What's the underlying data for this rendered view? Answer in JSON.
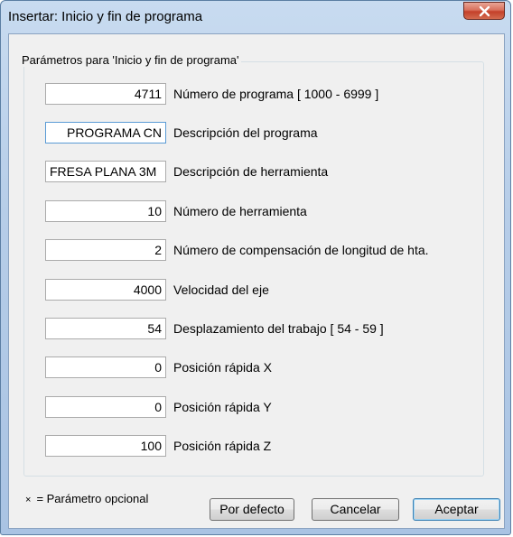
{
  "window": {
    "title": "Insertar: Inicio y fin de programa"
  },
  "group": {
    "label": "Parámetros para 'Inicio y fin de programa'"
  },
  "fields": [
    {
      "value": "4711",
      "label": "Número de programa  [ 1000 - 6999 ]"
    },
    {
      "value": "PROGRAMA CN",
      "label": "Descripción del programa"
    },
    {
      "value": "FRESA PLANA 3M",
      "label": "Descripción de herramienta"
    },
    {
      "value": "10",
      "label": "Número de herramienta"
    },
    {
      "value": "2",
      "label": "Número de compensación de longitud de hta."
    },
    {
      "value": "4000",
      "label": "Velocidad del eje"
    },
    {
      "value": "54",
      "label": "Desplazamiento del trabajo  [ 54 - 59 ]"
    },
    {
      "value": "0",
      "label": "Posición rápida X"
    },
    {
      "value": "0",
      "label": "Posición rápida Y"
    },
    {
      "value": "100",
      "label": "Posición rápida Z"
    }
  ],
  "footer": {
    "optional_marker": "×",
    "optional_note": "=  Parámetro opcional"
  },
  "buttons": {
    "defaults_label": "Por defecto",
    "cancel_label": "Cancelar",
    "accept_label": "Aceptar"
  },
  "colors": {
    "close_button": "#c4402a",
    "focus_border": "#5a9bd5",
    "client_background": "#f0f0f0"
  }
}
